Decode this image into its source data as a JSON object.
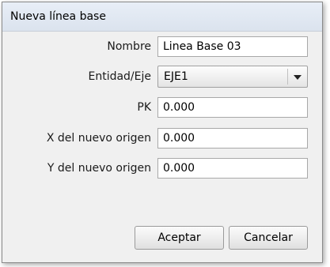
{
  "dialog": {
    "title": "Nueva línea base"
  },
  "form": {
    "nombre_label": "Nombre",
    "nombre_value": "Linea Base 03",
    "entidad_label": "Entidad/Eje",
    "entidad_value": "EJE1",
    "pk_label": "PK",
    "pk_value": "0.000",
    "x_label": "X del nuevo origen",
    "x_value": "0.000",
    "y_label": "Y del nuevo origen",
    "y_value": "0.000"
  },
  "buttons": {
    "accept_label": "Aceptar",
    "cancel_label": "Cancelar"
  },
  "icons": {
    "dropdown": "chevron-down-icon"
  }
}
